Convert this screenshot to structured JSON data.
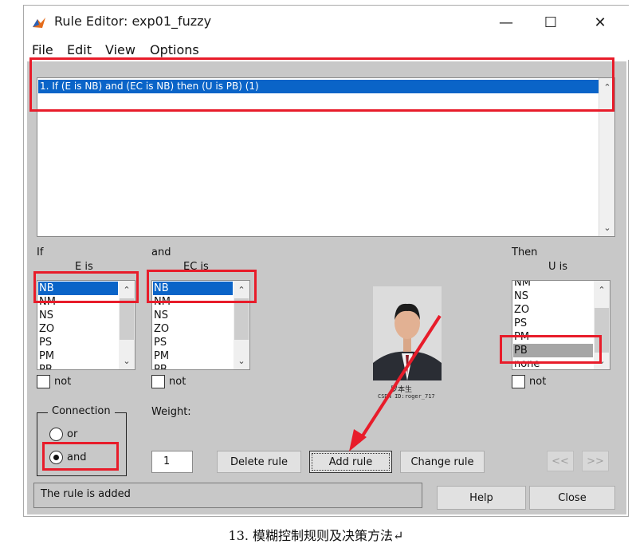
{
  "window": {
    "title": "Rule Editor: exp01_fuzzy"
  },
  "menu": [
    "File",
    "Edit",
    "View",
    "Options"
  ],
  "rules": [
    "1. If (E is NB) and (EC is NB) then (U is PB) (1)"
  ],
  "inputs": [
    {
      "header": "If",
      "var_label": "E is",
      "items": [
        "NB",
        "NM",
        "NS",
        "ZO",
        "PS",
        "PM",
        "PB"
      ],
      "selected": "NB",
      "not_label": "not"
    },
    {
      "header": "and",
      "var_label": "EC is",
      "items": [
        "NB",
        "NM",
        "NS",
        "ZO",
        "PS",
        "PM",
        "PB"
      ],
      "selected": "NB",
      "not_label": "not"
    }
  ],
  "output": {
    "header": "Then",
    "var_label": "U is",
    "items": [
      "NM",
      "NS",
      "ZO",
      "PS",
      "PM",
      "PB",
      "none"
    ],
    "selected": "PB",
    "not_label": "not"
  },
  "connection": {
    "title": "Connection",
    "options": [
      "or",
      "and"
    ],
    "selected": "and"
  },
  "weight": {
    "label": "Weight:",
    "value": "1"
  },
  "buttons": {
    "delete": "Delete rule",
    "add": "Add rule",
    "change": "Change rule",
    "prev": "<<",
    "next": ">>",
    "help": "Help",
    "close": "Close"
  },
  "status": "The rule is added",
  "photo": {
    "name_caption": "罗本生",
    "id_caption": "CSDN ID:roger_717"
  },
  "caption": "13. 模糊控制规则及决策方法↵",
  "colors": {
    "selection": "#0a64c8",
    "panel": "#c8c8c8",
    "annotation": "#e81c2a"
  }
}
